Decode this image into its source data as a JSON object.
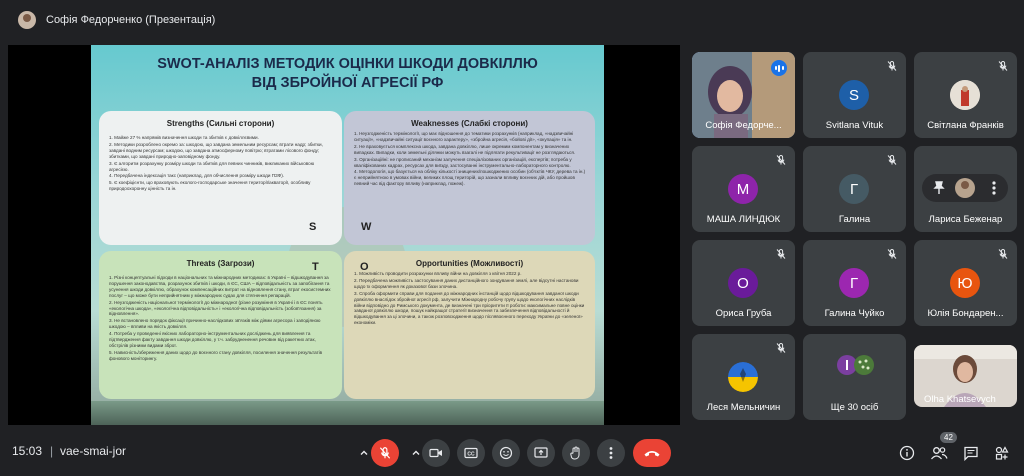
{
  "top_bar": {
    "presenter_title": "Софія Федорченко (Презентація)"
  },
  "slide": {
    "title_line1": "SWOT-АНАЛІЗ МЕТОДИК ОЦІНКИ ШКОДИ ДОВКІЛЛЮ",
    "title_line2": "ВІД ЗБРОЙНОЇ АГРЕСІЇ РФ",
    "strengths": {
      "heading": "Strengths (Сильні сторони)",
      "items": [
        "1. Майже 27 % напрямів визначення шкоди та збитків є довкіллєвими.",
        "2. Методики розроблено окремо за: шкодою, що завдана земельним ресурсам; втрати надр; збитки, завдані водним ресурсам; шкодою, що завдана атмосферному повітрю; втратами лісового фонду; збитками, що завдані природно-заповідному фонду.",
        "3. Є алгоритм розрахунку розміру шкоди та збитків для певних чинників, викликаних військовою агресією.",
        "4. Передбачена індексація такс (наприклад, для обчислення розміру шкоди ПЗФ).",
        "5. Є коефіцієнти, що враховують еколого-господарське значення території/акваторії, особливу природоохоронну цінність та ін."
      ]
    },
    "weaknesses": {
      "heading": "Weaknesses (Слабкі сторони)",
      "items": [
        "1. Неузгодженість термінології, що має відношення до тематики розрахунків (наприклад, «надзвичайні ситуації», «надзвичайні ситуації воєнного характеру», «збройна агресія, «бойові дії», «окупація» та ін.",
        "2. Не враховується комплексна шкода, завдана довкіллю, лише окремим компонентам у визначених випадках. Випадки, коли земельні ділянки можуть взагалі не підлягати рекультивації не розглядаються.",
        "3. Організаційні: не прописаний механізм залучення спеціалізованих організацій, експертів; потреба у кваліфікованих кадрах, ресурсах для виїзду, застосуванні інструментально-лабораторного контролю.",
        "4. Методологія, що базується на обліку кількості знищених/пошкоджених особин (об'єктів ЧКУ, дерева та ін.) є неприйнятною в умовах війни, великих площ територій, що зазнали впливу воєнних дій, або пройшов певний час від фактору впливу (наприклад, пожеж)."
      ]
    },
    "threats": {
      "heading": "Threats (Загрози)",
      "items": [
        "1. Різні концептуальні підходи в національних та міжнародних методиках: в Україні – відшкодування за порушення законодавства, розрахунок збитків і шкоди, в ЄС, США – відповідальність за запобігання та усунення шкоди довкіллю, обрахунок компенсаційних витрат на відновлення стану, втрат екосистемних послуг – що може бути неприйнятним у міжнародних судах для стягнення репарацій.",
        "2. Неузгодженість національної термінології до міжнародної (різне розуміння в Україні і в ЄС понять «екологічна шкода», «екологічна відповідальність» і «екологічна відповідальність (зобов'язання) за відновлення».",
        "3. Не встановлено порядок фіксації причинно-наслідкових зв'язків між діями агресора і заподіяною шкодою – впливи на якість довкілля.",
        "4. Потреба у проведенні якісних лабораторно-інструментальних досліджень для виявлення та підтвердження факту завдання шкоди довкіллю, у т.ч. забрудненення речовин від ракетних атак, обстрілів різними видами зброї.",
        "5. Нависність/збереження даних щодо до воєнного стану довкілля, посилення значення результатів фонового моніторингу."
      ]
    },
    "opportunities": {
      "heading": "Opportunities (Можливості)",
      "items": [
        "1. Можливість проводити розрахунки впливу війни на довкілля з квітня 2022 р.",
        "2. Передбачена можливість застосування даних дистанційного зондування землі, але відсутні настанови щодо їх оформлення як доказової бази злочина.",
        "3. Спроба оформити справи для подання до міжнародних інстанцій щодо відшкодування завданої шкоди довкіллю внаслідок збройної агресії рф, залучити Міжнародну робочу групу щодо екологічних наслідків війни відповідно до Римського документа, де визначені три пріоритети її роботи: максимальне повне оцінки завданої довкіллю шкоди, пошук найкращої стратегії визначення та забезпечення відповідальності й відшкодування за ці злочини, а також розповсюдження щодо післявоєнного переходу України до «зеленої» економіки."
      ]
    },
    "letters": {
      "s": "S",
      "w": "W",
      "t": "T",
      "o": "O"
    }
  },
  "participants": [
    {
      "name": "Софія Федорче...",
      "type": "photo",
      "speaking": true
    },
    {
      "name": "Svitlana Vituk",
      "initial": "S",
      "color": "#1e5fa8",
      "muted": true
    },
    {
      "name": "Світлана Франків",
      "type": "photo-small",
      "muted": true
    },
    {
      "name": "МАША ЛИНДЮК",
      "initial": "M",
      "color": "#8e24aa",
      "muted": true
    },
    {
      "name": "Галина",
      "initial": "Г",
      "color": "#455a64",
      "muted": true
    },
    {
      "name": "Лариса Беженар",
      "type": "pinned",
      "muted": false
    },
    {
      "name": "Ориса Груба",
      "initial": "О",
      "color": "#6a1b9a",
      "muted": true
    },
    {
      "name": "Галина Чуйко",
      "initial": "Г",
      "color": "#9c27b0",
      "muted": true
    },
    {
      "name": "Юлія Бондарен...",
      "initial": "Ю",
      "color": "#e8550f",
      "muted": true
    },
    {
      "name": "Леся Мельничин",
      "type": "flag",
      "muted": true
    },
    {
      "name": "Ще 30 осіб",
      "type": "others",
      "muted": false
    },
    {
      "name": "Olha Khatsevych",
      "type": "photo-woman",
      "muted": false
    }
  ],
  "bottom_bar": {
    "time": "15:03",
    "separator": "|",
    "meeting_code": "vae-smai-jor",
    "participant_count": "42"
  },
  "colors": {
    "accent_blue": "#8ab4f8",
    "end_call_red": "#ea4335",
    "tile_bg": "#3c4043"
  }
}
